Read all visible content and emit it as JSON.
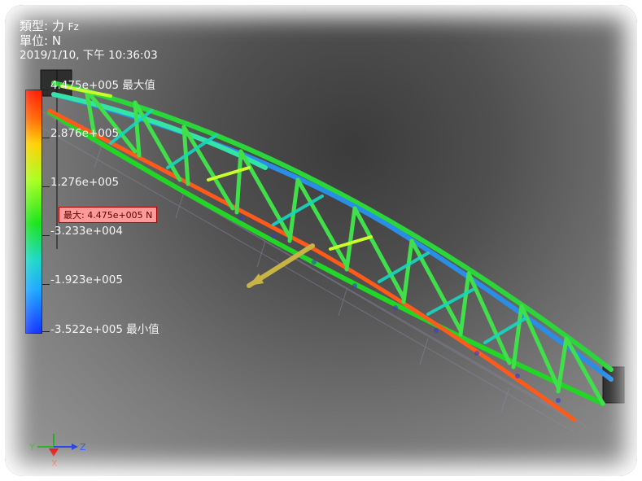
{
  "info": {
    "type_label": "類型: 力",
    "type_value": "Fz",
    "unit_label": "單位: N",
    "date": "2019/1/10, 下午 10:36:03"
  },
  "legend": {
    "ticks": [
      {
        "value": "4.475e+005 最大值"
      },
      {
        "value": "2.876e+005"
      },
      {
        "value": "1.276e+005"
      },
      {
        "value": "-3.233e+004"
      },
      {
        "value": "-1.923e+005"
      },
      {
        "value": "-3.522e+005 最小值"
      }
    ],
    "colors": [
      "#ff1a00",
      "#ffd000",
      "#a9ff1a",
      "#17e41a",
      "#19d8c8",
      "#1aa8ff",
      "#1133ff"
    ]
  },
  "max_callout": "最大: 4.475e+005 N",
  "axes": {
    "x": "X",
    "y": "Y",
    "z": "Z"
  }
}
